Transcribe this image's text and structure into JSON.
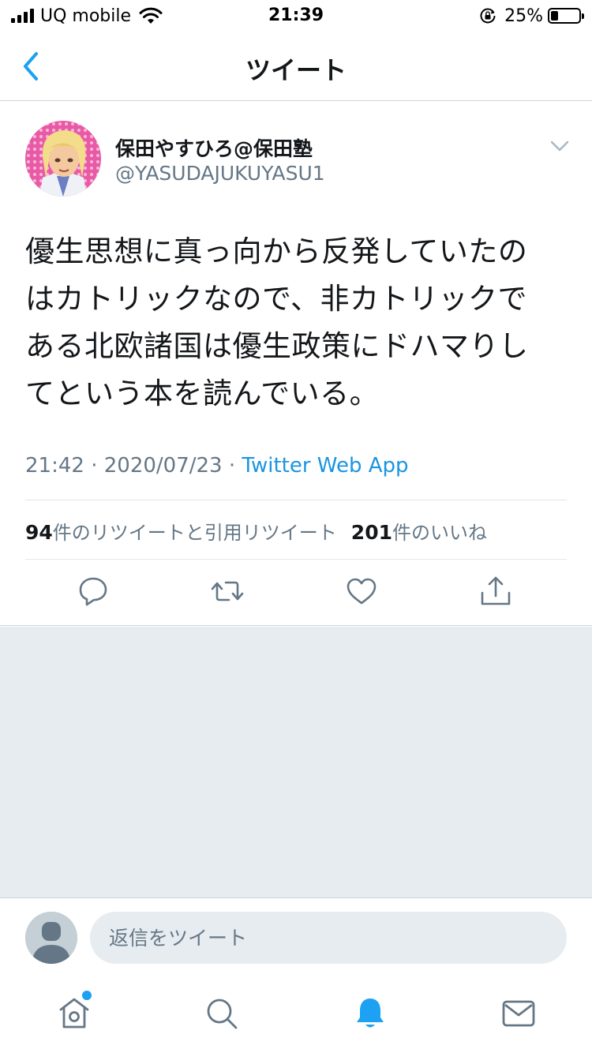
{
  "status_bar": {
    "carrier": "UQ mobile",
    "time": "21:39",
    "battery_percent": "25%",
    "battery_level": 0.25,
    "icons": [
      "signal-icon",
      "wifi-icon",
      "orientation-lock-icon",
      "battery-icon"
    ]
  },
  "nav": {
    "title": "ツイート",
    "back_icon": "chevron-left-icon"
  },
  "tweet": {
    "display_name": "保田やすひろ@保田塾",
    "handle": "@YASUDAJUKUYASU1",
    "text_lines": [
      "優生思想に真っ向から反発していたの",
      "はカトリックなので、非カトリックで",
      "ある北欧諸国は優生政策にドハマりし",
      "てという本を読んでいる。"
    ],
    "time": "21:42",
    "date": "2020/07/23",
    "separator": " · ",
    "source": "Twitter Web App",
    "retweet_count": "94",
    "retweet_label": "件のリツイートと引用リツイート",
    "like_count": "201",
    "like_label": "件のいいね",
    "actions": [
      "reply-icon",
      "retweet-icon",
      "like-icon",
      "share-icon"
    ]
  },
  "reply": {
    "placeholder": "返信をツイート"
  },
  "tabs": {
    "items": [
      "home-icon",
      "search-icon",
      "notifications-icon",
      "messages-icon"
    ],
    "active": "notifications-icon",
    "home_has_badge": true
  },
  "colors": {
    "accent": "#1da1f2",
    "link": "#1b95e0",
    "secondary_text": "#657786",
    "background_gray": "#e6ecf0"
  }
}
